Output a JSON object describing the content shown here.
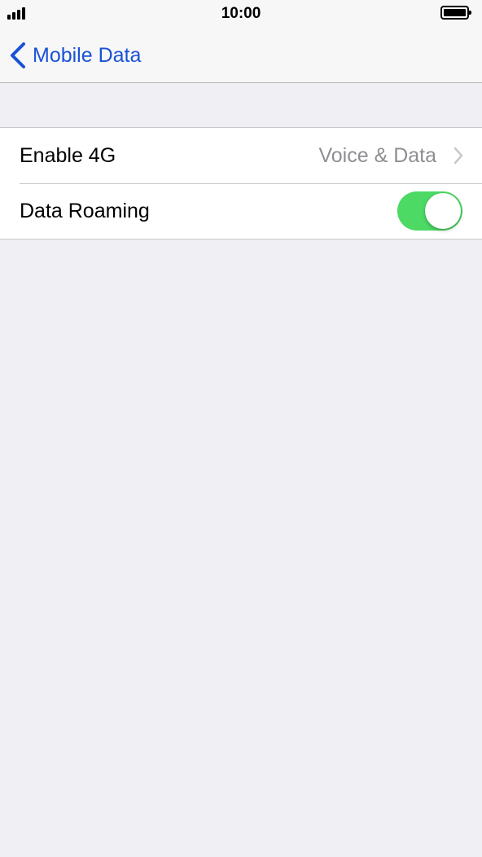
{
  "status_bar": {
    "time": "10:00",
    "signal_bars": 4,
    "battery_level": 1.0
  },
  "nav": {
    "back_label": "Mobile Data",
    "back_icon": "chevron-left-icon",
    "accent_color": "#1a52d6"
  },
  "settings": {
    "rows": [
      {
        "label": "Enable 4G",
        "value": "Voice & Data",
        "accessory": "chevron-right-icon"
      },
      {
        "label": "Data Roaming",
        "toggle_on": true,
        "toggle_color": "#4cd964"
      }
    ]
  }
}
